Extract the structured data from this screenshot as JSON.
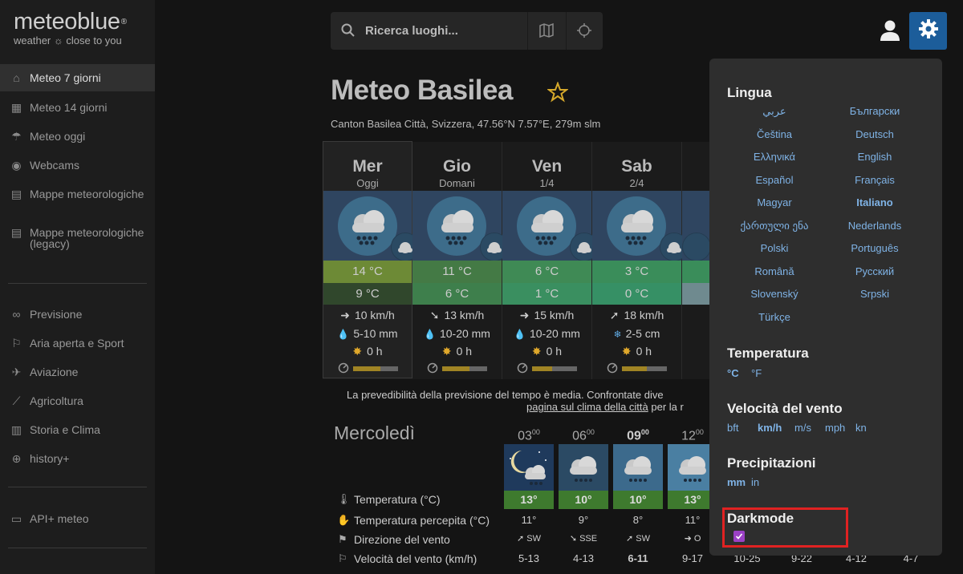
{
  "brand": {
    "name": "meteoblue",
    "tagline": "weather ☼ close to you"
  },
  "sidebar": {
    "items": [
      {
        "label": "Meteo 7 giorni",
        "icon": "home-icon"
      },
      {
        "label": "Meteo 14 giorni",
        "icon": "calendar-icon"
      },
      {
        "label": "Meteo oggi",
        "icon": "weather-icon"
      },
      {
        "label": "Webcams",
        "icon": "webcam-icon"
      },
      {
        "label": "Mappe meteorologiche",
        "icon": "map-icon"
      },
      {
        "label": "Mappe meteorologiche (legacy)",
        "icon": "map-icon"
      },
      {
        "label": "Previsione",
        "icon": "binoculars-icon"
      },
      {
        "label": "Aria aperta e Sport",
        "icon": "hiking-icon"
      },
      {
        "label": "Aviazione",
        "icon": "plane-icon"
      },
      {
        "label": "Agricoltura",
        "icon": "wheat-icon"
      },
      {
        "label": "Storia e Clima",
        "icon": "chart-icon"
      },
      {
        "label": "history+",
        "icon": "history-plus-icon"
      },
      {
        "label": "API+ meteo",
        "icon": "api-icon"
      }
    ]
  },
  "search": {
    "placeholder": "Ricerca luoghi..."
  },
  "page": {
    "title": "Meteo Basilea",
    "location": "Canton Basilea Città, Svizzera, 47.56°N 7.57°E, 279m slm"
  },
  "days": [
    {
      "name": "Mer",
      "date": "Oggi",
      "tmax": "14 °C",
      "tmin": "9 °C",
      "wind": "10 km/h",
      "wind_arrow": "➜",
      "precip": "5-10 mm",
      "precip_icon": "drop",
      "sun": "0 h",
      "predictability": 0.6,
      "tmax_color": "#6d8a36",
      "tmin_color": "#30472c"
    },
    {
      "name": "Gio",
      "date": "Domani",
      "tmax": "11 °C",
      "tmin": "6 °C",
      "wind": "13 km/h",
      "wind_arrow": "➘",
      "precip": "10-20 mm",
      "precip_icon": "drop",
      "sun": "0 h",
      "predictability": 0.6,
      "tmax_color": "#447a45",
      "tmin_color": "#3e7f4c"
    },
    {
      "name": "Ven",
      "date": "1/4",
      "tmax": "6 °C",
      "tmin": "1 °C",
      "wind": "15 km/h",
      "wind_arrow": "➜",
      "precip": "10-20 mm",
      "precip_icon": "drop",
      "sun": "0 h",
      "predictability": 0.45,
      "tmax_color": "#3f8a55",
      "tmin_color": "#3a8f60"
    },
    {
      "name": "Sab",
      "date": "2/4",
      "tmax": "3 °C",
      "tmin": "0 °C",
      "wind": "18 km/h",
      "wind_arrow": "➚",
      "precip": "2-5 cm",
      "precip_icon": "snowflake",
      "sun": "0 h",
      "predictability": 0.55,
      "tmax_color": "#3a8d5a",
      "tmin_color": "#369065"
    }
  ],
  "predictability_note": "La prevedibilità della previsione del tempo è media. Confrontate dive",
  "predictability_link": "pagina sul clima della città",
  "predictability_tail": "per la r",
  "hourly": {
    "day_label": "Mercoledì",
    "hours": [
      {
        "h": "03",
        "m": "00",
        "temp": "13°",
        "felt": "11°",
        "dir": "SW",
        "speed": "5-13"
      },
      {
        "h": "06",
        "m": "00",
        "temp": "10°",
        "felt": "9°",
        "dir": "SSE",
        "speed": "4-13"
      },
      {
        "h": "09",
        "m": "00",
        "temp": "10°",
        "felt": "8°",
        "dir": "SW",
        "speed": "6-11"
      },
      {
        "h": "12",
        "m": "00",
        "temp": "13°",
        "felt": "11°",
        "dir": "O",
        "speed": "9-17"
      },
      {
        "h": "",
        "m": "",
        "temp": "",
        "felt": "",
        "dir": "",
        "speed": "10-25"
      },
      {
        "h": "",
        "m": "",
        "temp": "",
        "felt": "",
        "dir": "",
        "speed": "9-22"
      },
      {
        "h": "",
        "m": "",
        "temp": "",
        "felt": "",
        "dir": "",
        "speed": "4-12"
      },
      {
        "h": "",
        "m": "",
        "temp": "",
        "felt": "",
        "dir": "",
        "speed": "4-7"
      }
    ],
    "rows": {
      "temperature": "Temperatura (°C)",
      "felt": "Temperatura percepita (°C)",
      "direction": "Direzione del vento",
      "speed": "Velocità del vento (km/h)"
    }
  },
  "settings": {
    "language_title": "Lingua",
    "languages": [
      "عربي",
      "Български",
      "Čeština",
      "Deutsch",
      "Ελληνικά",
      "English",
      "Español",
      "Français",
      "Magyar",
      "Italiano",
      "ქართული ენა",
      "Nederlands",
      "Polski",
      "Português",
      "Română",
      "Русский",
      "Slovenský",
      "Srpski",
      "Türkçe"
    ],
    "current_language": "Italiano",
    "temperature_title": "Temperatura",
    "temperature_units": [
      "°C",
      "°F"
    ],
    "temperature_current": "°C",
    "wind_title": "Velocità del vento",
    "wind_units": [
      "bft",
      "km/h",
      "m/s",
      "mph",
      "kn"
    ],
    "wind_current": "km/h",
    "precip_title": "Precipitazioni",
    "precip_units": [
      "mm",
      "in"
    ],
    "precip_current": "mm",
    "darkmode_title": "Darkmode",
    "darkmode_on": true
  },
  "colors": {
    "accent": "#1c5d9a",
    "link": "#7fb3e6",
    "highlight": "#e02222",
    "checkbox": "#9b41c5"
  }
}
